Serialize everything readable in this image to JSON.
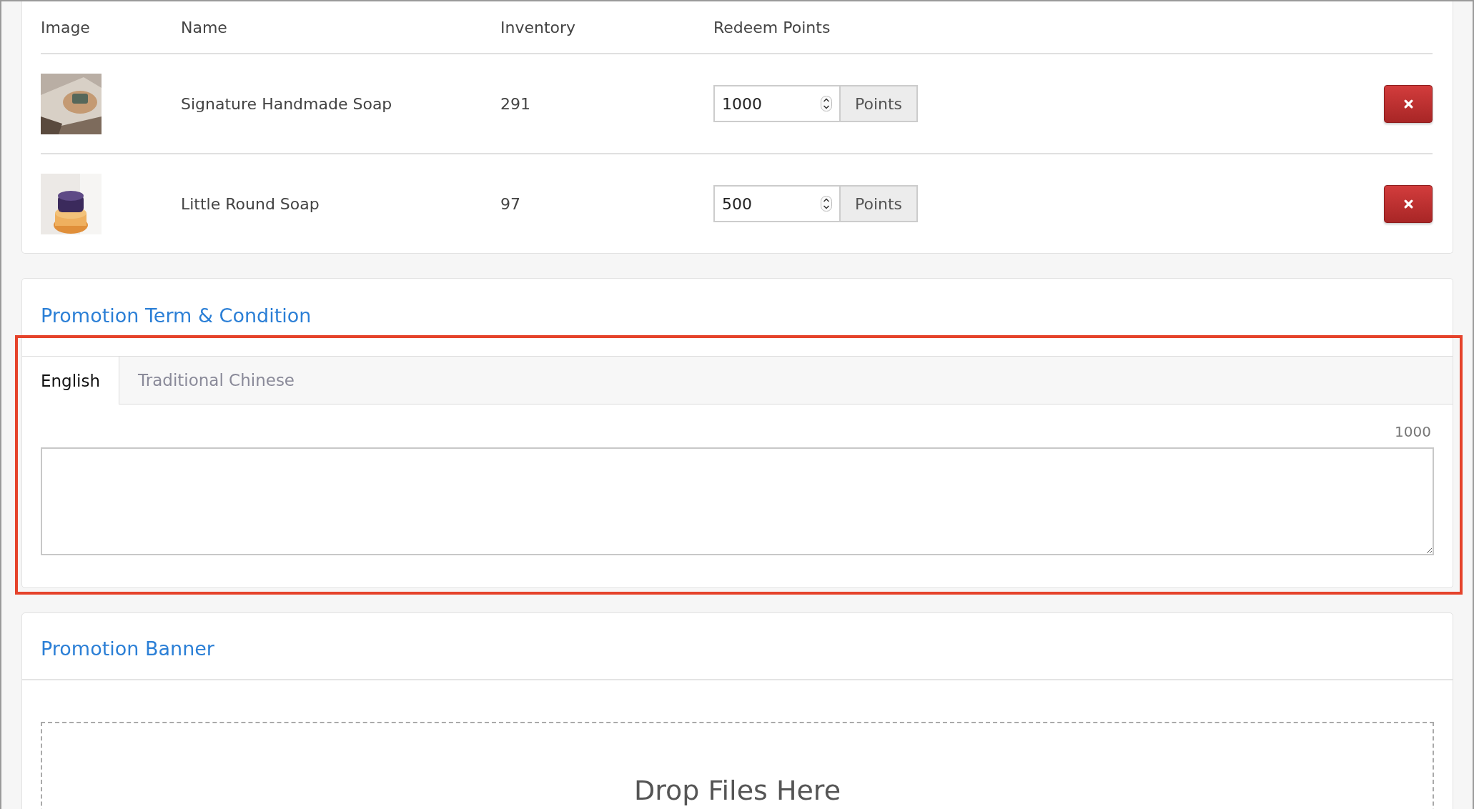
{
  "products": {
    "columns": [
      "Image",
      "Name",
      "Inventory",
      "Redeem Points"
    ],
    "rows": [
      {
        "name": "Signature Handmade Soap",
        "inventory": "291",
        "points": "1000",
        "unit": "Points"
      },
      {
        "name": "Little Round Soap",
        "inventory": "97",
        "points": "500",
        "unit": "Points"
      }
    ]
  },
  "terms": {
    "title": "Promotion Term & Condition",
    "tabs": [
      {
        "label": "English",
        "selected": true
      },
      {
        "label": "Traditional Chinese",
        "selected": false
      }
    ],
    "counter": "1000"
  },
  "banner": {
    "title": "Promotion Banner",
    "dropzone": "Drop Files Here"
  }
}
